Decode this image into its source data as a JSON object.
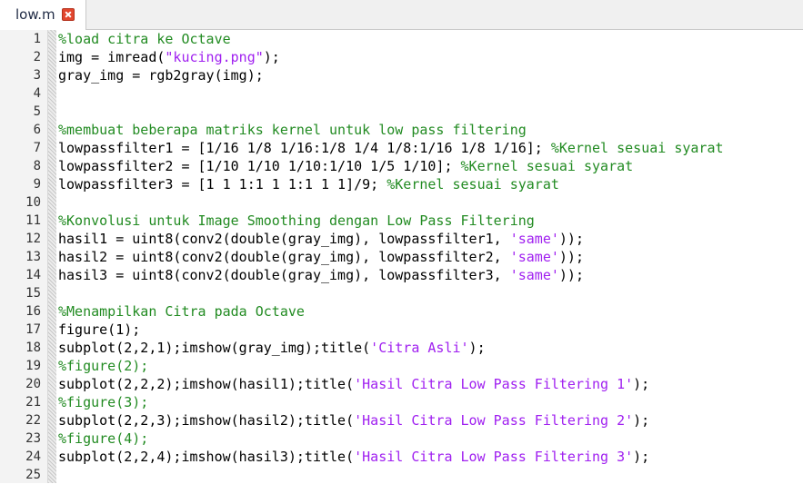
{
  "tab": {
    "label": "low.m",
    "close_icon": "close-icon"
  },
  "colors": {
    "comment": "#228b22",
    "string": "#a020f0",
    "close_button": "#e2462e"
  },
  "editor": {
    "lines": [
      {
        "n": "1",
        "segments": [
          {
            "t": "%load citra ke Octave",
            "c": "comment"
          }
        ]
      },
      {
        "n": "2",
        "segments": [
          {
            "t": "img = imread(",
            "c": ""
          },
          {
            "t": "\"kucing.png\"",
            "c": "string"
          },
          {
            "t": ");",
            "c": ""
          }
        ]
      },
      {
        "n": "3",
        "segments": [
          {
            "t": "gray_img = rgb2gray(img);",
            "c": ""
          }
        ]
      },
      {
        "n": "4",
        "segments": []
      },
      {
        "n": "5",
        "segments": []
      },
      {
        "n": "6",
        "segments": [
          {
            "t": "%membuat beberapa matriks kernel untuk low pass filtering",
            "c": "comment"
          }
        ]
      },
      {
        "n": "7",
        "segments": [
          {
            "t": "lowpassfilter1 = [1/16 1/8 1/16:1/8 1/4 1/8:1/16 1/8 1/16]; ",
            "c": ""
          },
          {
            "t": "%Kernel sesuai syarat",
            "c": "comment"
          }
        ]
      },
      {
        "n": "8",
        "segments": [
          {
            "t": "lowpassfilter2 = [1/10 1/10 1/10:1/10 1/5 1/10]; ",
            "c": ""
          },
          {
            "t": "%Kernel sesuai syarat",
            "c": "comment"
          }
        ]
      },
      {
        "n": "9",
        "segments": [
          {
            "t": "lowpassfilter3 = [1 1 1:1 1 1:1 1 1]/9; ",
            "c": ""
          },
          {
            "t": "%Kernel sesuai syarat",
            "c": "comment"
          }
        ]
      },
      {
        "n": "10",
        "segments": []
      },
      {
        "n": "11",
        "segments": [
          {
            "t": "%Konvolusi untuk Image Smoothing dengan Low Pass Filtering",
            "c": "comment"
          }
        ]
      },
      {
        "n": "12",
        "segments": [
          {
            "t": "hasil1 = uint8(conv2(double(gray_img), lowpassfilter1, ",
            "c": ""
          },
          {
            "t": "'same'",
            "c": "string"
          },
          {
            "t": "));",
            "c": ""
          }
        ]
      },
      {
        "n": "13",
        "segments": [
          {
            "t": "hasil2 = uint8(conv2(double(gray_img), lowpassfilter2, ",
            "c": ""
          },
          {
            "t": "'same'",
            "c": "string"
          },
          {
            "t": "));",
            "c": ""
          }
        ]
      },
      {
        "n": "14",
        "segments": [
          {
            "t": "hasil3 = uint8(conv2(double(gray_img), lowpassfilter3, ",
            "c": ""
          },
          {
            "t": "'same'",
            "c": "string"
          },
          {
            "t": "));",
            "c": ""
          }
        ]
      },
      {
        "n": "15",
        "segments": []
      },
      {
        "n": "16",
        "segments": [
          {
            "t": "%Menampilkan Citra pada Octave",
            "c": "comment"
          }
        ]
      },
      {
        "n": "17",
        "segments": [
          {
            "t": "figure(1);",
            "c": ""
          }
        ]
      },
      {
        "n": "18",
        "segments": [
          {
            "t": "subplot(2,2,1);imshow(gray_img);title(",
            "c": ""
          },
          {
            "t": "'Citra Asli'",
            "c": "string"
          },
          {
            "t": ");",
            "c": ""
          }
        ]
      },
      {
        "n": "19",
        "segments": [
          {
            "t": "%figure(2);",
            "c": "comment"
          }
        ]
      },
      {
        "n": "20",
        "segments": [
          {
            "t": "subplot(2,2,2);imshow(hasil1);title(",
            "c": ""
          },
          {
            "t": "'Hasil Citra Low Pass Filtering 1'",
            "c": "string"
          },
          {
            "t": ");",
            "c": ""
          }
        ]
      },
      {
        "n": "21",
        "segments": [
          {
            "t": "%figure(3);",
            "c": "comment"
          }
        ]
      },
      {
        "n": "22",
        "segments": [
          {
            "t": "subplot(2,2,3);imshow(hasil2);title(",
            "c": ""
          },
          {
            "t": "'Hasil Citra Low Pass Filtering 2'",
            "c": "string"
          },
          {
            "t": ");",
            "c": ""
          }
        ]
      },
      {
        "n": "23",
        "segments": [
          {
            "t": "%figure(4);",
            "c": "comment"
          }
        ]
      },
      {
        "n": "24",
        "segments": [
          {
            "t": "subplot(2,2,4);imshow(hasil3);title(",
            "c": ""
          },
          {
            "t": "'Hasil Citra Low Pass Filtering 3'",
            "c": "string"
          },
          {
            "t": ");",
            "c": ""
          }
        ]
      },
      {
        "n": "25",
        "segments": []
      }
    ]
  }
}
